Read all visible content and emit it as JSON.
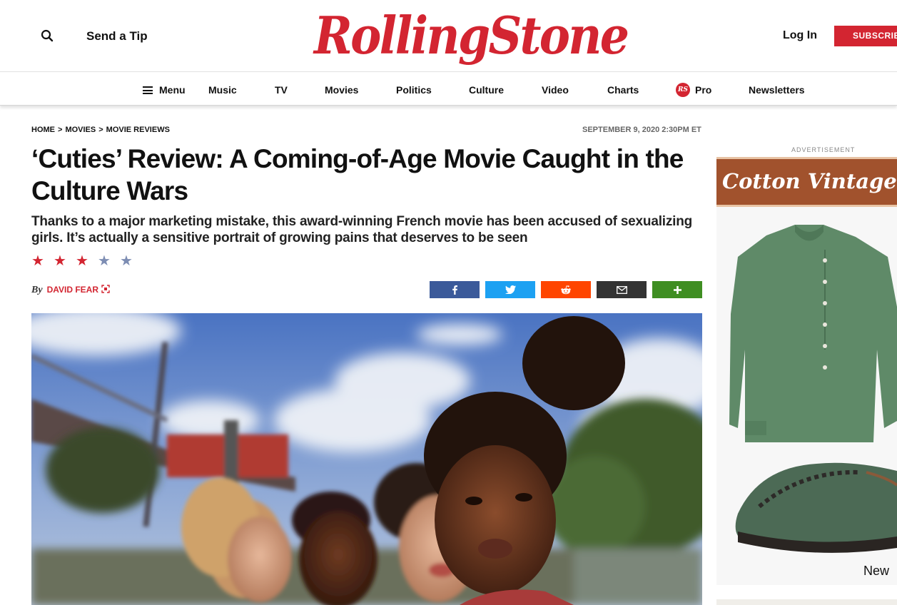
{
  "header": {
    "tip_label": "Send a Tip",
    "logo_text": "RollingStone",
    "login_label": "Log In",
    "subscribe_label": "SUBSCRIBE"
  },
  "nav": {
    "menu_label": "Menu",
    "items": [
      "Music",
      "TV",
      "Movies",
      "Politics",
      "Culture",
      "Video",
      "Charts",
      "Pro",
      "Newsletters"
    ],
    "pro_badge": "RS"
  },
  "article": {
    "breadcrumb": [
      "HOME",
      "MOVIES",
      "MOVIE REVIEWS"
    ],
    "breadcrumb_sep": ">",
    "date": "SEPTEMBER 9, 2020 2:30PM ET",
    "headline": "‘Cuties’ Review: A Coming-of-Age Movie Caught in the Culture Wars",
    "dek": "Thanks to a major marketing mistake, this award-winning French movie has been accused of sexualizing girls. It’s actually a sensitive portrait of growing pains that deserves to be seen",
    "rating": {
      "value": 3,
      "max": 5,
      "filled_color": "#d32531",
      "empty_color": "#7d8db3"
    },
    "byline_prefix": "By",
    "author": "DAVID FEAR"
  },
  "share": [
    {
      "icon": "facebook-icon",
      "color": "#3b5a9a"
    },
    {
      "icon": "twitter-icon",
      "color": "#1da1f2"
    },
    {
      "icon": "reddit-icon",
      "color": "#ff4500"
    },
    {
      "icon": "email-icon",
      "color": "#333333"
    },
    {
      "icon": "plus-icon",
      "color": "#3f8e22"
    }
  ],
  "sidebar": {
    "ad_label": "ADVERTISEMENT",
    "ad_brand": "Cotton Vintage Look",
    "ad_cta": "New"
  },
  "colors": {
    "brand": "#d32531"
  }
}
